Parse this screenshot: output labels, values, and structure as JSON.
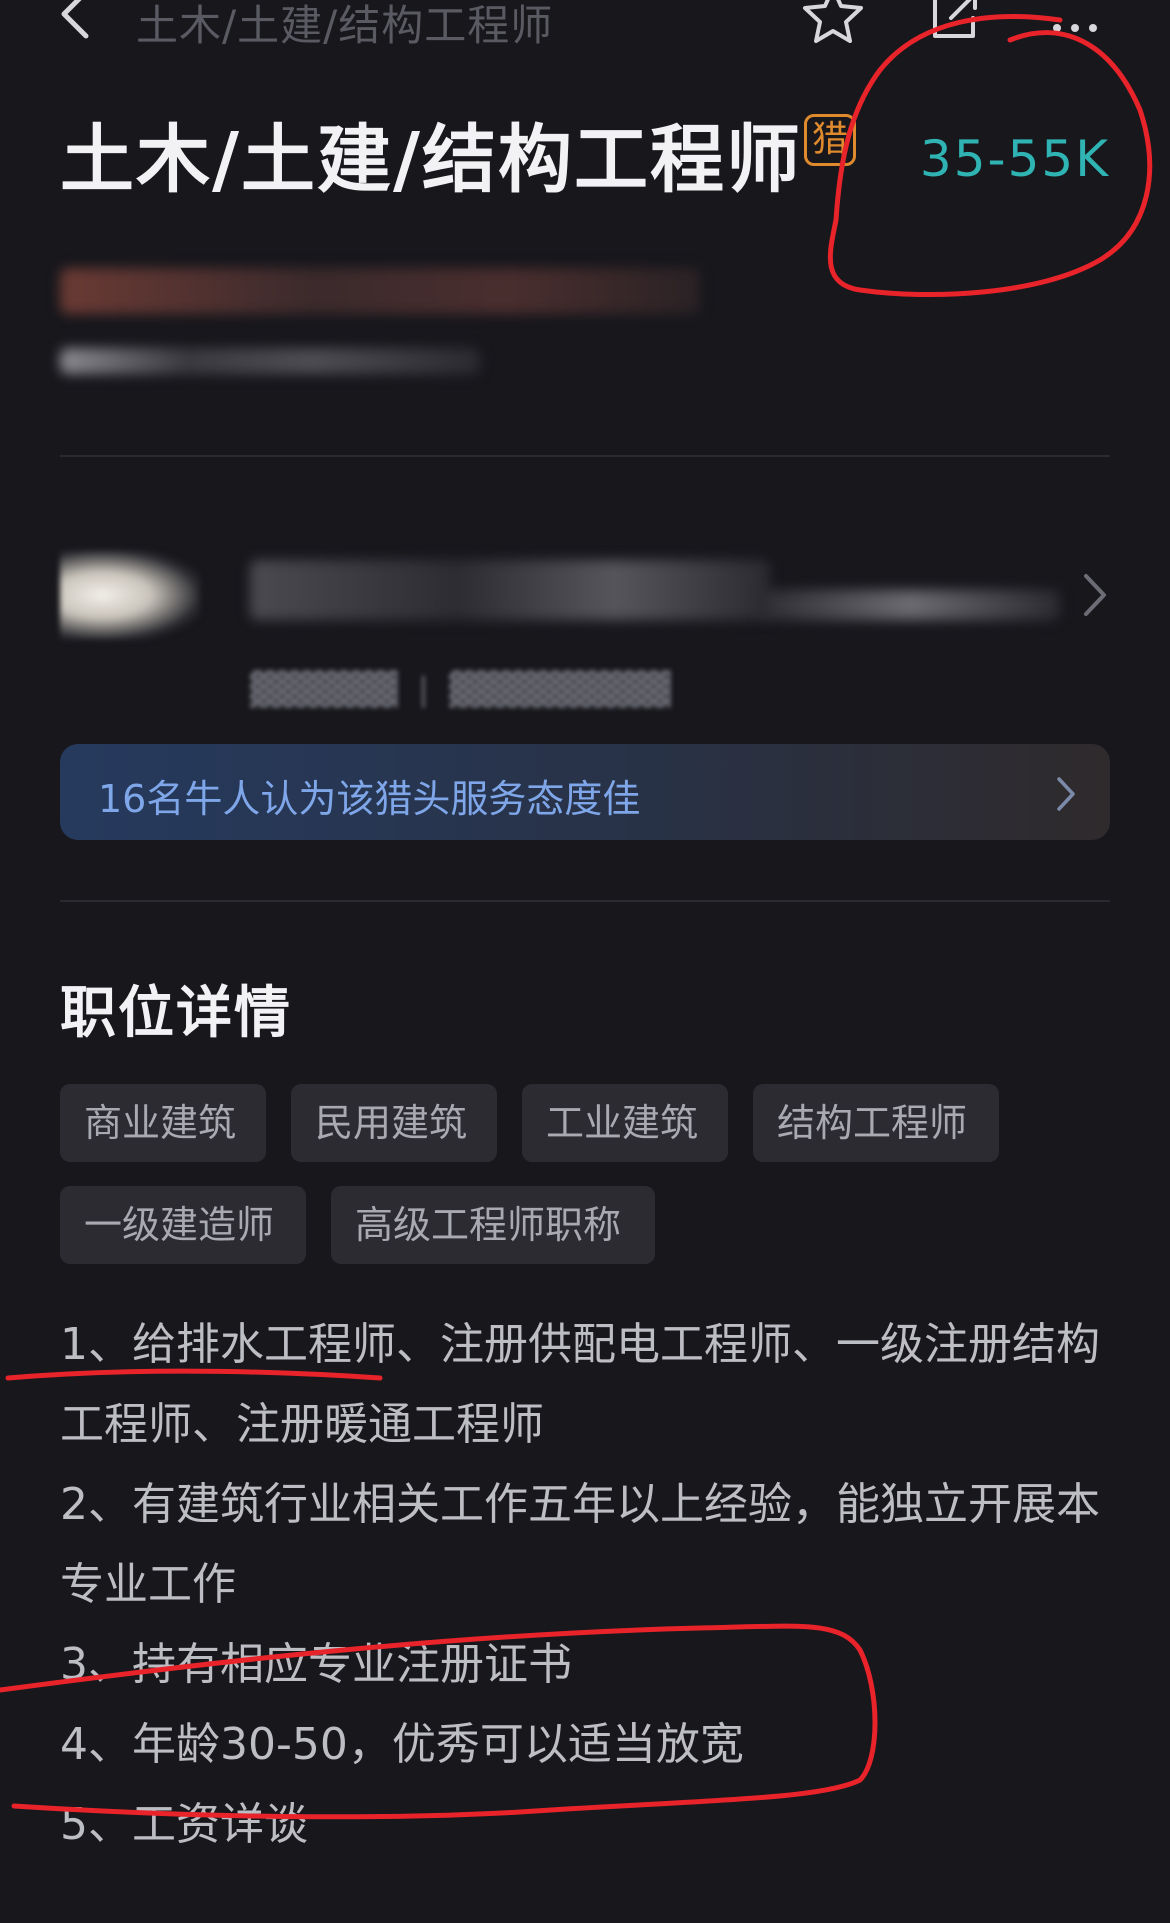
{
  "nav": {
    "title": "土木/土建/结构工程师",
    "icons": [
      "back-icon",
      "star-icon",
      "share-icon",
      "more-icon"
    ]
  },
  "job": {
    "title": "土木/土建/结构工程师",
    "badge": "猎",
    "salary": "35-55K"
  },
  "rating_banner": {
    "text": "16名牛人认为该猎头服务态度佳"
  },
  "details": {
    "heading": "职位详情",
    "tags": [
      "商业建筑",
      "民用建筑",
      "工业建筑",
      "结构工程师",
      "一级建造师",
      "高级工程师职称"
    ],
    "requirements": [
      "1、给排水工程师、注册供配电工程师、一级注册结构工程师、注册暖通工程师",
      "2、有建筑行业相关工作五年以上经验，能独立开展本专业工作",
      "3、持有相应专业注册证书",
      "4、年龄30-50，优秀可以适当放宽",
      "5、工资详谈"
    ]
  },
  "colors": {
    "background": "#17171c",
    "salary": "#2fb3b3",
    "badge": "#e08a2e",
    "banner_text": "#7ea6e8",
    "annotation": "#e8232a"
  }
}
